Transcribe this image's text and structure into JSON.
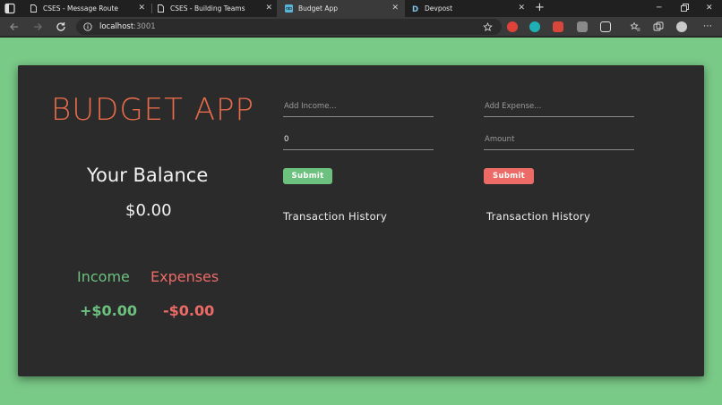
{
  "browser": {
    "tabs": [
      {
        "title": "CSES - Message Route"
      },
      {
        "title": "CSES - Building Teams"
      },
      {
        "title": "Budget App"
      },
      {
        "title": "Devpost"
      }
    ],
    "address": {
      "host": "localhost",
      "port": ":3001"
    }
  },
  "app": {
    "title": "BUDGET APP",
    "balance_label": "Your Balance",
    "balance_value": "$0.00",
    "income_label": "Income",
    "expense_label": "Expenses",
    "income_value": "+$0.00",
    "expense_value": "-$0.00",
    "income_form": {
      "text_placeholder": "Add Income...",
      "amount_value": "0",
      "submit_label": "Submit",
      "history_title": "Transaction History"
    },
    "expense_form": {
      "text_placeholder": "Add Expense...",
      "amount_placeholder": "Amount",
      "submit_label": "Submit",
      "history_title": "Transaction History"
    }
  },
  "colors": {
    "page_background": "#79c987",
    "card_background": "#2b2b2b",
    "title": "#e66b4a",
    "income": "#6cc17f",
    "expense": "#ec6b66"
  }
}
